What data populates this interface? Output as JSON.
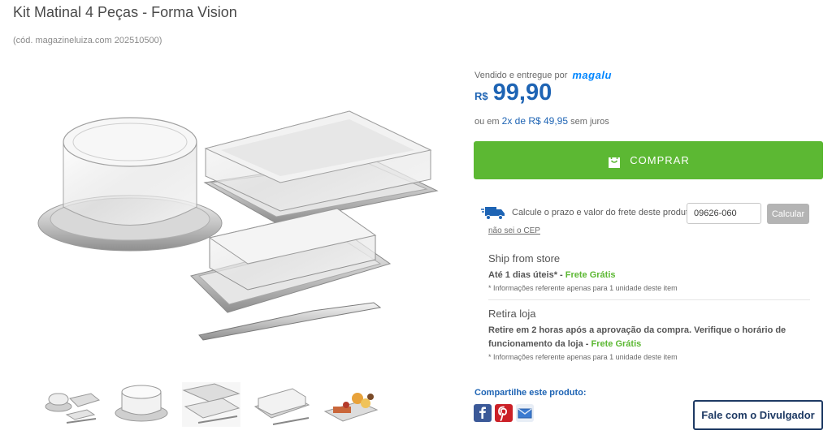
{
  "product": {
    "title": "Kit Matinal 4 Peças - Forma Vision",
    "code": "(cód. magazineluiza.com 202510500)"
  },
  "seller": {
    "label": "Vendido e entregue por",
    "brand": "magalu"
  },
  "price": {
    "currency": "R$",
    "value": "99,90",
    "install_prefix": "ou em",
    "install_value": "2x de R$ 49,95",
    "install_suffix": "sem juros"
  },
  "buy": {
    "label": "COMPRAR",
    "color": "#5cb833"
  },
  "shipping": {
    "prompt": "Calcule o prazo e valor do frete deste produto:",
    "cep_value": "09626-060",
    "calc_label": "Calcular",
    "nao_sei": "não sei o CEP"
  },
  "options": {
    "ship_store": {
      "title": "Ship from store",
      "line_prefix": "Até 1 dias úteis* - ",
      "free": "Frete Grátis",
      "note": "* Informações referente apenas para 1 unidade deste item"
    },
    "retira": {
      "title": "Retira loja",
      "line_prefix": "Retire em 2 horas após a aprovação da compra. Verifique o horário de funcionamento da loja - ",
      "free": "Frete Grátis",
      "note": "* Informações referente apenas para 1 unidade deste item"
    }
  },
  "share": {
    "label": "Compartilhe este produto:",
    "icons": [
      "facebook-icon",
      "pinterest-icon",
      "email-icon"
    ]
  },
  "divulgador": {
    "label": "Fale com o Divulgador"
  },
  "thumbnails": {
    "count": 5
  },
  "colors": {
    "price_blue": "#1e64b4",
    "brand_blue": "#0086ff",
    "green": "#5cb833",
    "dark_navy": "#1e3a64"
  }
}
